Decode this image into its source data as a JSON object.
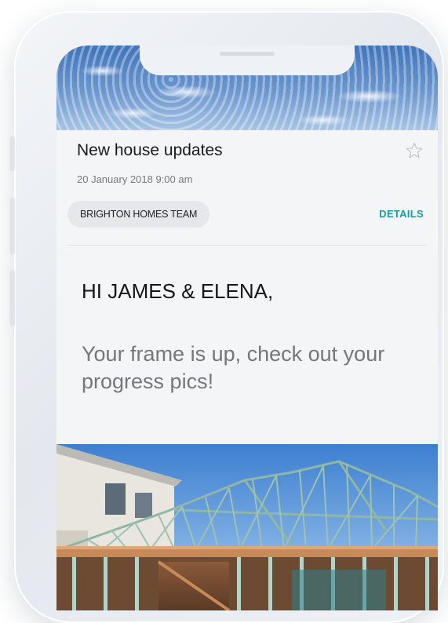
{
  "email": {
    "subject": "New house updates",
    "date": "20 January 2018  9:00 am",
    "sender": "BRIGHTON HOMES TEAM",
    "details_link": "DETAILS",
    "greeting": "HI JAMES & ELENA,",
    "message": "Your frame is up, check out your progress pics!"
  },
  "icons": {
    "star": "star-outline-icon"
  },
  "colors": {
    "accent": "#1f9aa3",
    "chip_background": "#e6e7ea",
    "body_text": "#74777b"
  }
}
